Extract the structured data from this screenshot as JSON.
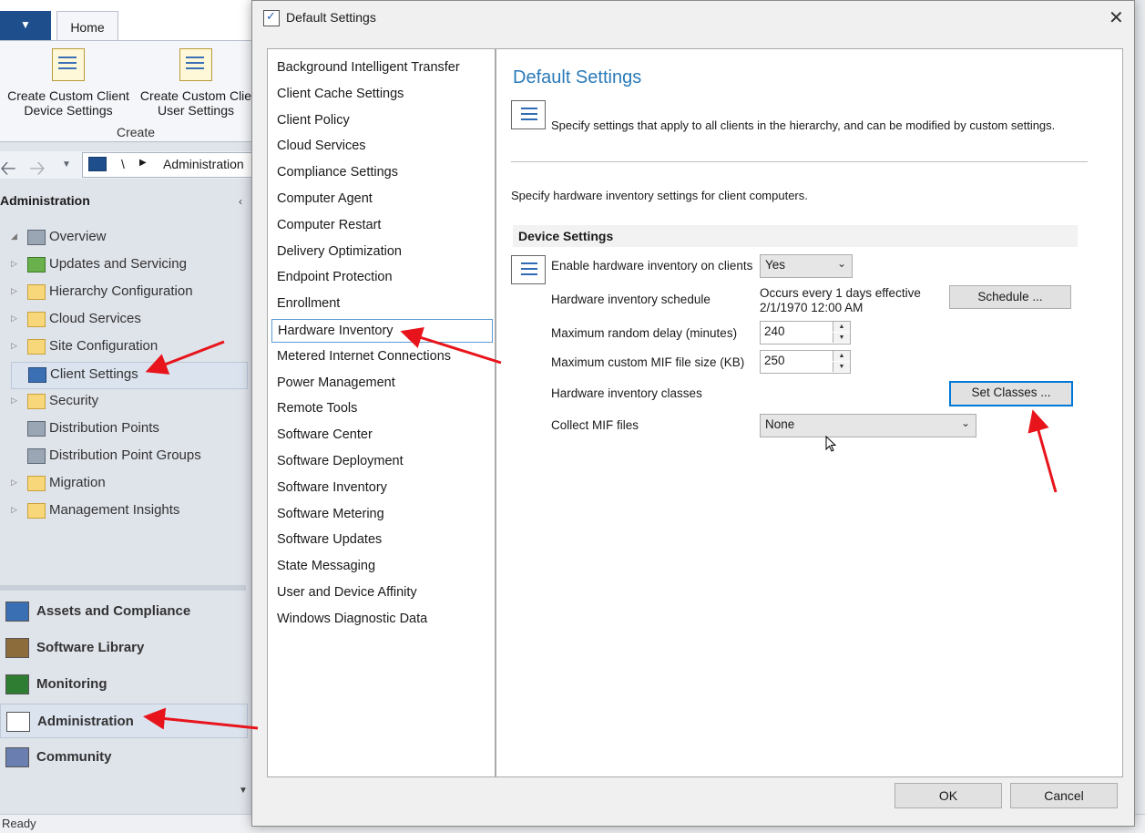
{
  "console": {
    "ribbon": {
      "home_tab": "Home",
      "buttons": [
        {
          "label": "Create Custom Client Device Settings",
          "line1": "Create Custom Client",
          "line2": "Device Settings"
        },
        {
          "label": "Create Custom Client User Settings",
          "line1": "Create Custom Clie",
          "line2": "User Settings"
        }
      ],
      "group_label": "Create"
    },
    "address": {
      "separator": "\\",
      "path": "Administration"
    },
    "workspace_header": "Administration",
    "tree": [
      {
        "label": "Overview",
        "icon": "overview-icon"
      },
      {
        "label": "Updates and Servicing",
        "icon": "updates-icon"
      },
      {
        "label": "Hierarchy Configuration",
        "icon": "folder-icon"
      },
      {
        "label": "Cloud Services",
        "icon": "folder-icon"
      },
      {
        "label": "Site Configuration",
        "icon": "folder-icon"
      },
      {
        "label": "Client Settings",
        "icon": "client-settings-icon",
        "selected": true
      },
      {
        "label": "Security",
        "icon": "folder-icon"
      },
      {
        "label": "Distribution Points",
        "icon": "distribution-point-icon"
      },
      {
        "label": "Distribution Point Groups",
        "icon": "distribution-group-icon"
      },
      {
        "label": "Migration",
        "icon": "folder-icon"
      },
      {
        "label": "Management Insights",
        "icon": "folder-icon"
      }
    ],
    "workspaces": [
      {
        "label": "Assets and Compliance",
        "icon": "assets-icon"
      },
      {
        "label": "Software Library",
        "icon": "software-library-icon"
      },
      {
        "label": "Monitoring",
        "icon": "monitoring-icon"
      },
      {
        "label": "Administration",
        "icon": "administration-icon",
        "active": true
      },
      {
        "label": "Community",
        "icon": "community-icon"
      }
    ],
    "status": "Ready"
  },
  "dialog": {
    "title": "Default Settings",
    "categories": [
      "Background Intelligent Transfer",
      "Client Cache Settings",
      "Client Policy",
      "Cloud Services",
      "Compliance Settings",
      "Computer Agent",
      "Computer Restart",
      "Delivery Optimization",
      "Endpoint Protection",
      "Enrollment",
      "Hardware Inventory",
      "Metered Internet Connections",
      "Power Management",
      "Remote Tools",
      "Software Center",
      "Software Deployment",
      "Software Inventory",
      "Software Metering",
      "Software Updates",
      "State Messaging",
      "User and Device Affinity",
      "Windows Diagnostic Data"
    ],
    "selected_category": "Hardware Inventory",
    "panel": {
      "title": "Default Settings",
      "description": "Specify settings that apply to all clients in the hierarchy, and can be modified by custom settings.",
      "subtitle": "Specify hardware inventory settings for client computers.",
      "section": "Device Settings",
      "enable_label": "Enable hardware inventory on clients",
      "enable_value": "Yes",
      "schedule_label": "Hardware inventory schedule",
      "schedule_line1": "Occurs every 1 days effective",
      "schedule_line2": "2/1/1970 12:00 AM",
      "schedule_button": "Schedule ...",
      "delay_label": "Maximum random delay (minutes)",
      "delay_value": "240",
      "mif_size_label": "Maximum custom MIF file size (KB)",
      "mif_size_value": "250",
      "classes_label": "Hardware inventory classes",
      "classes_button": "Set Classes ...",
      "collect_mif_label": "Collect MIF files",
      "collect_mif_value": "None"
    },
    "ok": "OK",
    "cancel": "Cancel"
  },
  "colors": {
    "accent_title": "#2a7ab8",
    "focus_border": "#0078d7",
    "annotation_arrow": "#e8141b"
  }
}
